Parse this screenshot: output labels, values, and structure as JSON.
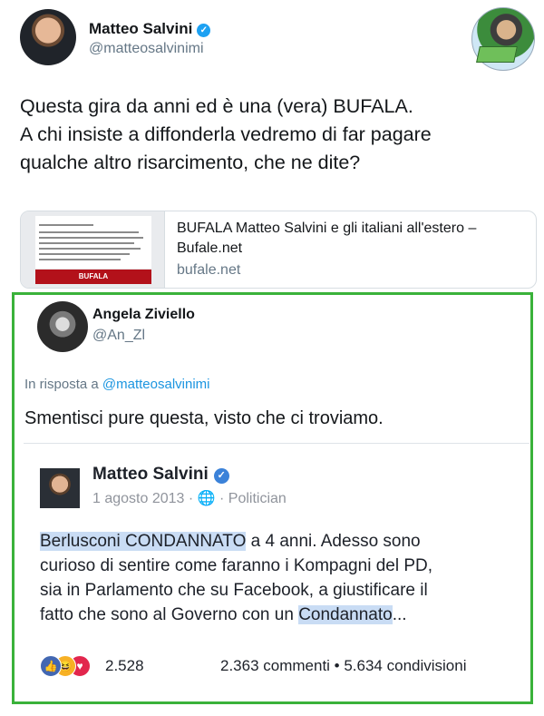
{
  "tweet": {
    "author_name": "Matteo Salvini",
    "author_handle": "@matteosalvinimi",
    "text_lines": [
      "Questa gira da anni ed è una (vera) BUFALA.",
      "A chi insiste a diffonderla vedremo di far pagare",
      "qualche altro risarcimento, che ne dite?"
    ],
    "link_card": {
      "title": "BUFALA Matteo Salvini e gli italiani all'estero – Bufale.net",
      "domain": "bufale.net",
      "thumb_label": "BUFALA"
    }
  },
  "reply": {
    "author_name": "Angela Ziviello",
    "author_handle": "@An_Zl",
    "in_reply_prefix": "In risposta a ",
    "in_reply_mention": "@matteosalvinimi",
    "text": "Smentisci pure questa, visto che ci troviamo."
  },
  "fb_post": {
    "author_name": "Matteo Salvini",
    "meta": "1 agosto 2013 · 🌐 · Politician",
    "body": {
      "l1_hl": "Berlusconi CONDANNATO",
      "l1_rest": " a 4 anni. Adesso sono",
      "l2": "curioso di sentire come faranno i Kompagni del PD,",
      "l3": "sia in Parlamento che su Facebook, a giustificare il",
      "l4_pre": "fatto che sono al Governo con un ",
      "l4_hl": "Condannato",
      "l4_post": "..."
    },
    "reactions_count": "2.528",
    "stats": "2.363 commenti • 5.634 condivisioni",
    "reaction_icons": [
      "like-icon",
      "haha-icon",
      "love-icon"
    ]
  },
  "colors": {
    "verified_twitter": "#1da1f2",
    "mention": "#1b95e0",
    "highlight_box": "#3ab23a",
    "text_highlight": "#c9dcf4"
  }
}
